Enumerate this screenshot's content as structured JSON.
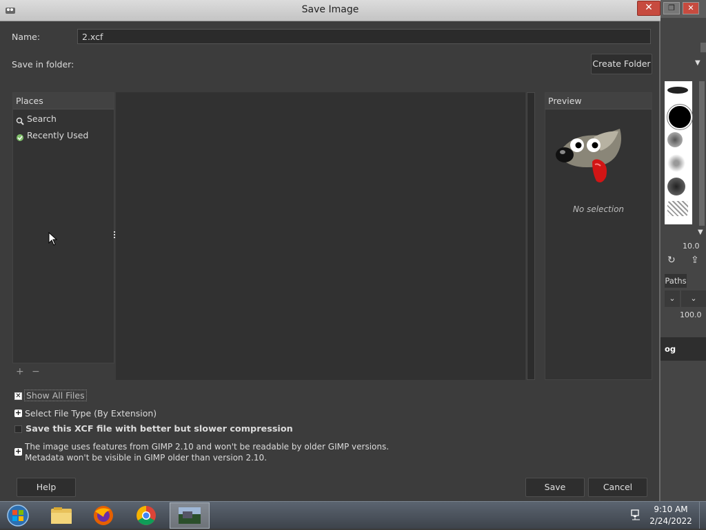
{
  "dialog": {
    "title": "Save Image",
    "close_label": "✕",
    "name_label": "Name:",
    "name_value": "2.xcf",
    "folder_label": "Save in folder:",
    "create_folder_label": "Create Folder",
    "places": {
      "header": "Places",
      "items": [
        {
          "label": "Search",
          "icon": "search-icon"
        },
        {
          "label": "Recently Used",
          "icon": "recent-icon"
        }
      ],
      "add_label": "+",
      "remove_label": "−"
    },
    "preview": {
      "header": "Preview",
      "empty_text": "No selection"
    },
    "show_all_files": {
      "label": "Show All Files",
      "checked": true
    },
    "select_file_type_label": "Select File Type (By Extension)",
    "compression": {
      "label": "Save this XCF file with better but slower compression",
      "checked": false
    },
    "compat_note": {
      "line1": "The image uses features from GIMP 2.10 and won't be readable by older GIMP versions.",
      "line2": "Metadata won't be visible in GIMP older than version 2.10."
    },
    "help_label": "Help",
    "save_label": "Save",
    "cancel_label": "Cancel"
  },
  "background_window": {
    "paths_tab": "Paths",
    "value_1": "10.0",
    "value_2": "100.0",
    "partial_label": "og"
  },
  "taskbar": {
    "time": "9:10 AM",
    "date": "2/24/2022",
    "apps": [
      "start-orb",
      "file-explorer",
      "firefox",
      "chrome",
      "gimp"
    ]
  },
  "colors": {
    "dialog_bg": "#3c3c3c",
    "close_button": "#c74b3f",
    "taskbar": "#4a525c"
  }
}
